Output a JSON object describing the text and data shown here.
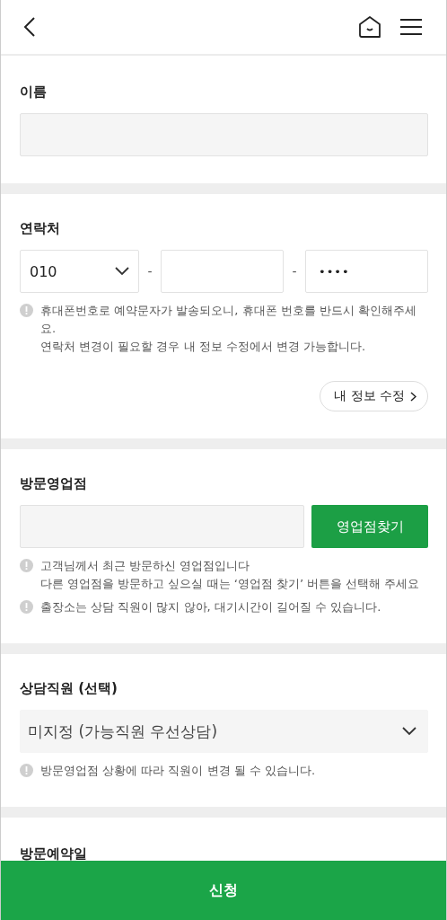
{
  "sections": [
    {
      "kind": "name",
      "label": "이름",
      "field": {
        "disabled": true
      }
    },
    {
      "kind": "phone",
      "label": "연락처",
      "prefix": "010",
      "separator": "-",
      "last": "••••",
      "notes": [
        {
          "lines": [
            "휴대폰번호로 예약문자가 발송되오니, 휴대폰 번호를 반드시 확인해주세요.",
            "연락처 변경이 필요할 경우 내 정보 수정에서 변경 가능합니다."
          ]
        }
      ],
      "link_button": "내 정보 수정"
    },
    {
      "kind": "branch",
      "label": "방문영업점",
      "button": "영업점찾기",
      "notes": [
        {
          "lines": [
            "고객님께서 최근 방문하신 영업점입니다",
            "다른 영업점을 방문하고 싶으실 때는 ‘영업점 찾기’ 버튼을 선택해 주세요"
          ]
        },
        {
          "lines": [
            "출장소는 상담 직원이 많지 않아, 대기시간이 길어질 수 있습니다."
          ]
        }
      ]
    },
    {
      "kind": "staff",
      "label": "상담직원 (선택)",
      "value": "미지정 (가능직원 우선상담)",
      "notes": [
        {
          "lines": [
            "방문영업점 상황에 따라 직원이 변경 될 수 있습니다."
          ]
        }
      ]
    },
    {
      "kind": "date",
      "label": "방문예약일"
    }
  ],
  "submit": "신청"
}
